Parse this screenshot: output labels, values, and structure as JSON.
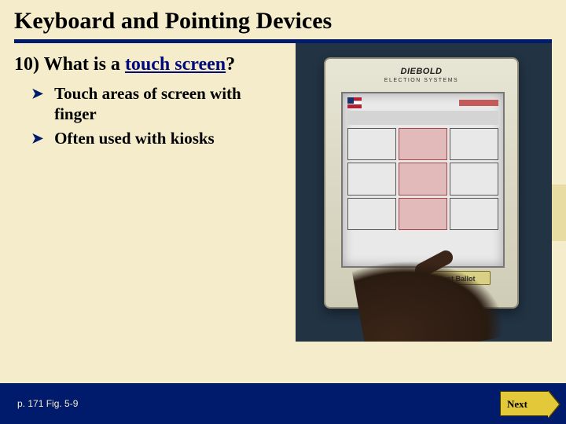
{
  "title": "Keyboard and Pointing Devices",
  "question": {
    "number": "10)",
    "prefix": "What is a ",
    "link": "touch screen",
    "suffix": "?"
  },
  "bullets": [
    "Touch areas of screen with finger",
    "Often used with kiosks"
  ],
  "photo": {
    "brand": "DIEBOLD",
    "subtitle": "ELECTION SYSTEMS",
    "button_label": "Cast Ballot"
  },
  "footer": {
    "page_ref": "p. 171 Fig. 5-9",
    "next_label": "Next"
  },
  "colors": {
    "background": "#f5eccb",
    "accent": "#001b6b",
    "next_button": "#e3c93a"
  }
}
